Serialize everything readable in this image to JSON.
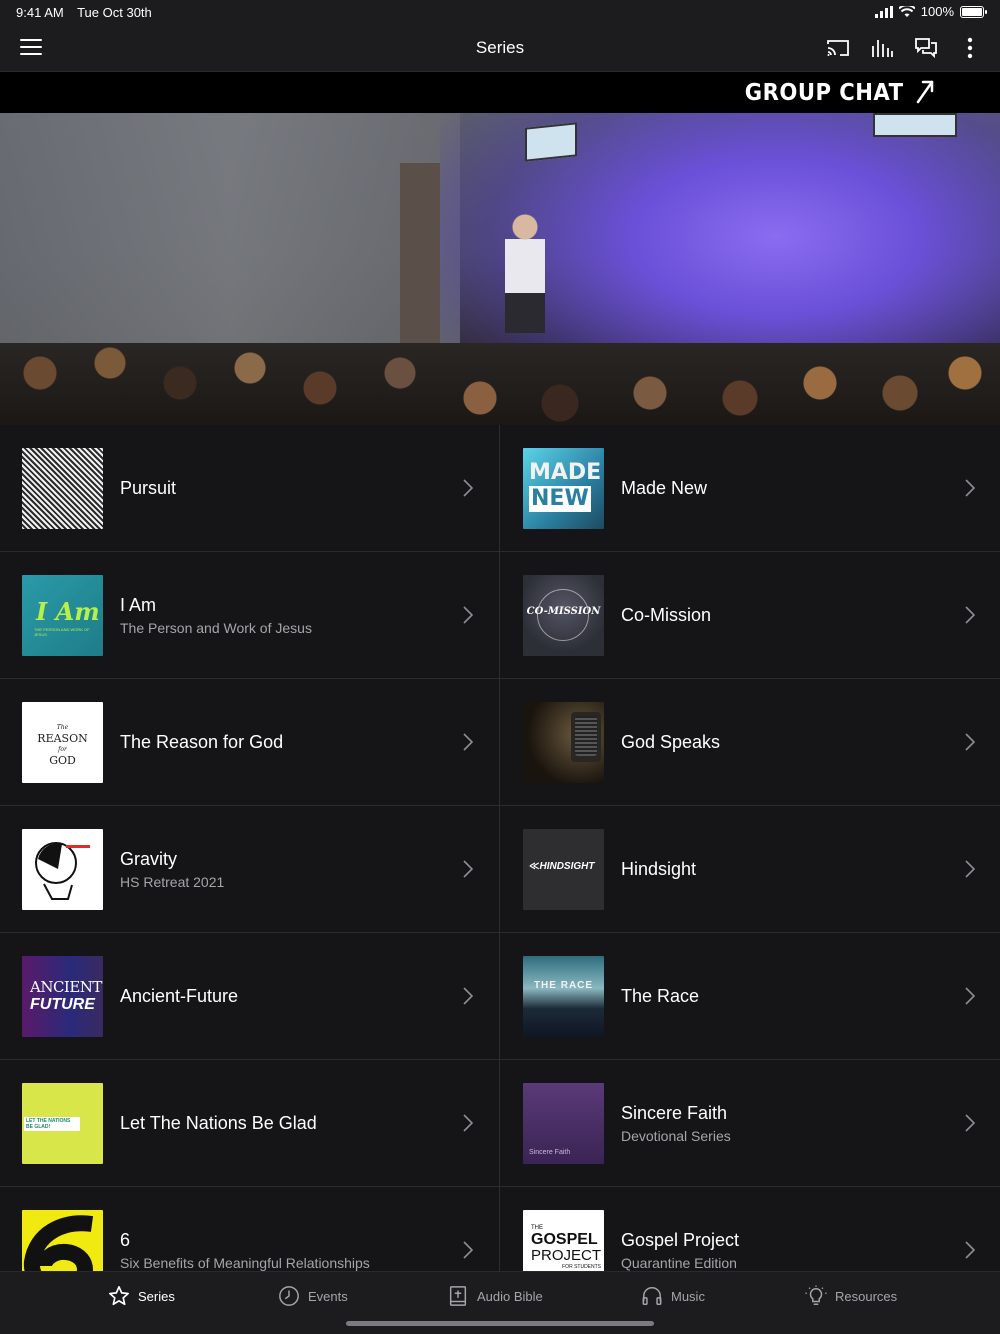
{
  "status": {
    "time": "9:41 AM",
    "date": "Tue Oct 30th",
    "battery": "100%"
  },
  "nav": {
    "title": "Series"
  },
  "banner": {
    "label": "GROUP CHAT"
  },
  "series": [
    {
      "left": {
        "name": "Pursuit",
        "sub": ""
      },
      "right": {
        "name": "Made New",
        "sub": ""
      }
    },
    {
      "left": {
        "name": "I Am",
        "sub": "The Person and Work of Jesus"
      },
      "right": {
        "name": "Co-Mission",
        "sub": ""
      }
    },
    {
      "left": {
        "name": "The Reason for God",
        "sub": ""
      },
      "right": {
        "name": "God Speaks",
        "sub": ""
      }
    },
    {
      "left": {
        "name": "Gravity",
        "sub": "HS Retreat 2021"
      },
      "right": {
        "name": "Hindsight",
        "sub": ""
      }
    },
    {
      "left": {
        "name": "Ancient-Future",
        "sub": ""
      },
      "right": {
        "name": "The Race",
        "sub": ""
      }
    },
    {
      "left": {
        "name": "Let The Nations Be Glad",
        "sub": ""
      },
      "right": {
        "name": "Sincere Faith",
        "sub": "Devotional Series"
      }
    },
    {
      "left": {
        "name": "6",
        "sub": "Six Benefits of Meaningful Relationships"
      },
      "right": {
        "name": "Gospel Project",
        "sub": "Quarantine Edition"
      }
    }
  ],
  "thumb_text": {
    "madenew_1": "MADE",
    "madenew_2": "NEW",
    "iam": "I Am",
    "iam_sub": "THE PERSON AND WORK OF JESUS",
    "comission": "CO-MISSION",
    "reason_the": "The",
    "reason_reason": "REASON",
    "reason_for": "for",
    "reason_god": "GOD",
    "hindsight": "≪HINDSIGHT",
    "ancient_1": "ANCIENT",
    "ancient_2": "FUTURE",
    "race": "THE RACE",
    "nations": "LET THE NATIONS BE GLAD!",
    "sincere": "Sincere Faith",
    "gospel_the": "THE",
    "gospel_1": "GOSPEL",
    "gospel_2": "PROJECT",
    "gospel_sub": "FOR STUDENTS"
  },
  "tabs": [
    {
      "label": "Series",
      "icon": "star-icon",
      "active": true
    },
    {
      "label": "Events",
      "icon": "clock-icon"
    },
    {
      "label": "Audio Bible",
      "icon": "bible-icon"
    },
    {
      "label": "Music",
      "icon": "headphones-icon"
    },
    {
      "label": "Resources",
      "icon": "lightbulb-icon"
    }
  ]
}
